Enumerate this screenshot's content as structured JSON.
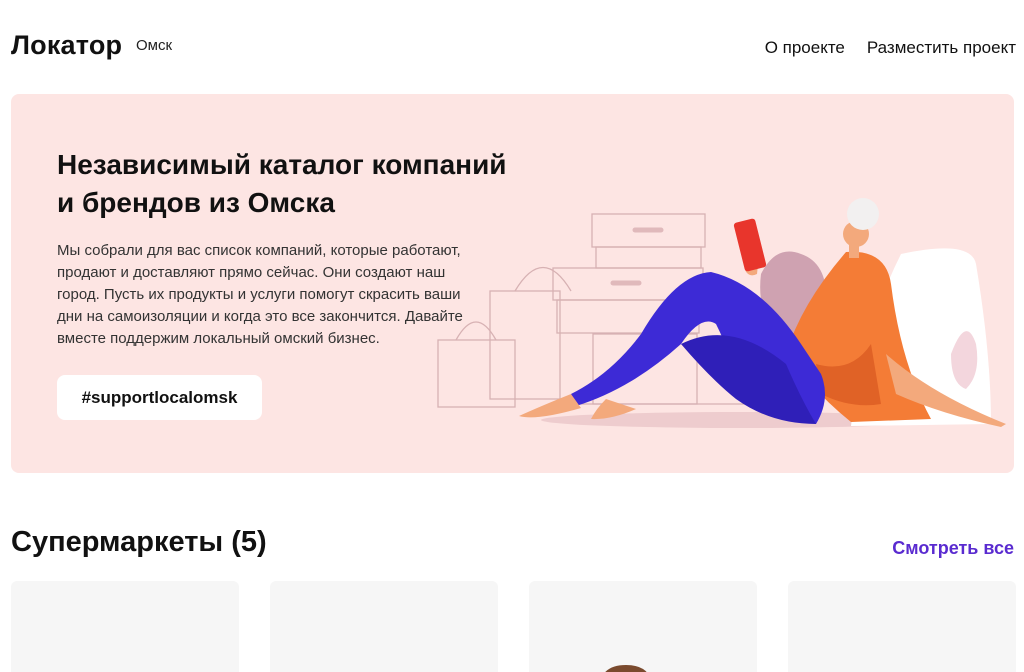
{
  "header": {
    "logo": "Локатор",
    "city": "Омск",
    "nav": [
      {
        "label": "О проекте"
      },
      {
        "label": "Разместить проект"
      }
    ]
  },
  "hero": {
    "title": "Независимый каталог компаний и брендов из Омска",
    "description": "Мы собрали для вас список компаний, которые работают, продают и доставляют прямо сейчас. Они создают наш город. Пусть их продукты и услуги помогут скрасить ваши дни на самоизоляции и когда это все закончится. Давайте вместе поддержим локальный омский бизнес.",
    "tag_button": "#supportlocalomsk"
  },
  "section": {
    "title": "Супермаркеты (5)",
    "see_all": "Смотреть все"
  },
  "colors": {
    "hero_bg": "#fde5e3",
    "accent": "#5a2bd0"
  },
  "cards": [
    {
      "name": ""
    },
    {
      "name": ""
    },
    {
      "name": ""
    },
    {
      "name": ""
    }
  ]
}
